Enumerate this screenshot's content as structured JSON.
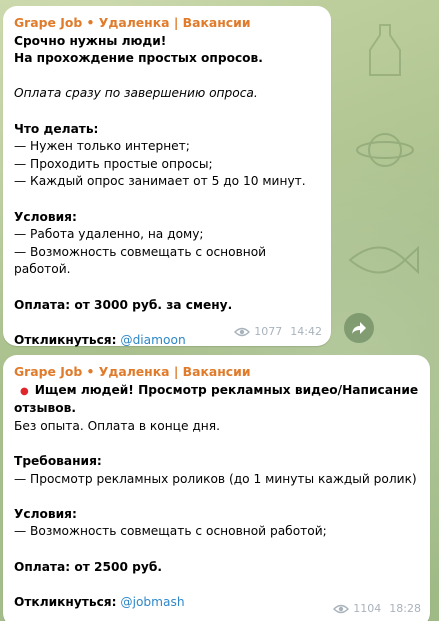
{
  "posts": [
    {
      "channel": "Grape Job • Удаленка | Вакансии",
      "title_line1": "Срочно нужны люди!",
      "title_line2": "На прохождение простых опросов.",
      "italic_line": "Оплата сразу по завершению опроса.",
      "section1_title": "Что делать:",
      "section1_items": [
        "— Нужен только интернет;",
        "— Проходить простые опросы;",
        "— Каждый опрос занимает от 5 до 10 минут."
      ],
      "section2_title": "Условия:",
      "section2_items": [
        "— Работа удаленно, на дому;",
        "— Возможность совмещать с основной работой."
      ],
      "pay": "Оплата: от 3000 руб. за смену.",
      "respond_label": "Откликнуться:",
      "respond_link": "@diamoon",
      "views": "1077",
      "time": "14:42"
    },
    {
      "channel": "Grape Job • Удаленка | Вакансии",
      "title_line1": "Ищем людей! Просмотр рекламных видео/Написание",
      "title_line2": "отзывов.",
      "plain_line": "Без опыта. Оплата в конце дня.",
      "section1_title": "Требования:",
      "section1_items": [
        "— Просмотр рекламных роликов (до 1 минуты каждый ролик)"
      ],
      "section2_title": "Условия:",
      "section2_items": [
        "— Возможность совмещать с основной работой;"
      ],
      "pay": "Оплата: от 2500 руб.",
      "respond_label": "Откликнуться:",
      "respond_link": "@jobmash",
      "views": "1104",
      "time": "18:28"
    }
  ],
  "colors": {
    "channel": "#e07b2b",
    "link": "#2f87c8",
    "meta": "#a9b3bc",
    "red_dot": "#e0252b"
  },
  "icons": {
    "views": "eye-icon",
    "share": "share-arrow-icon",
    "bullet": "red-circle-icon"
  }
}
